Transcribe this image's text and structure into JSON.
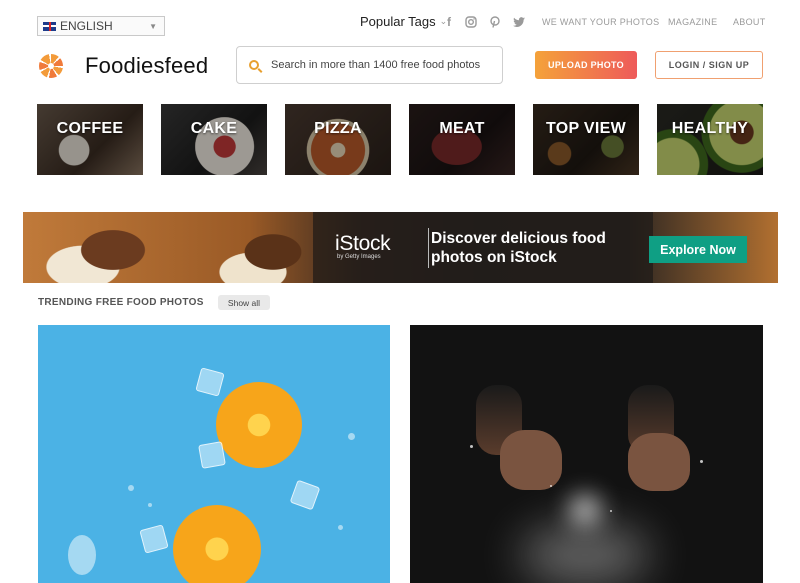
{
  "topbar": {
    "language": "ENGLISH",
    "popular_tags": "Popular Tags",
    "links": [
      "WE WANT YOUR PHOTOS",
      "MAGAZINE",
      "ABOUT"
    ]
  },
  "header": {
    "brand": "Foodiesfeed",
    "search_placeholder": "Search in more than 1400 free food photos",
    "upload_label": "UPLOAD PHOTO",
    "login_label": "LOGIN / SIGN UP"
  },
  "categories": [
    "COFFEE",
    "CAKE",
    "PIZZA",
    "MEAT",
    "TOP VIEW",
    "HEALTHY"
  ],
  "banner": {
    "logo": "iStock",
    "logo_sub": "by Getty Images",
    "text": "Discover delicious food photos on iStock",
    "cta": "Explore Now"
  },
  "trending": {
    "title": "TRENDING FREE FOOD PHOTOS",
    "show_all": "Show all"
  },
  "colors": {
    "accent_orange": "#f4a23a",
    "accent_red": "#ee5a5a",
    "explore_green": "#0f9f84",
    "photo_blue": "#4bb2e5"
  }
}
